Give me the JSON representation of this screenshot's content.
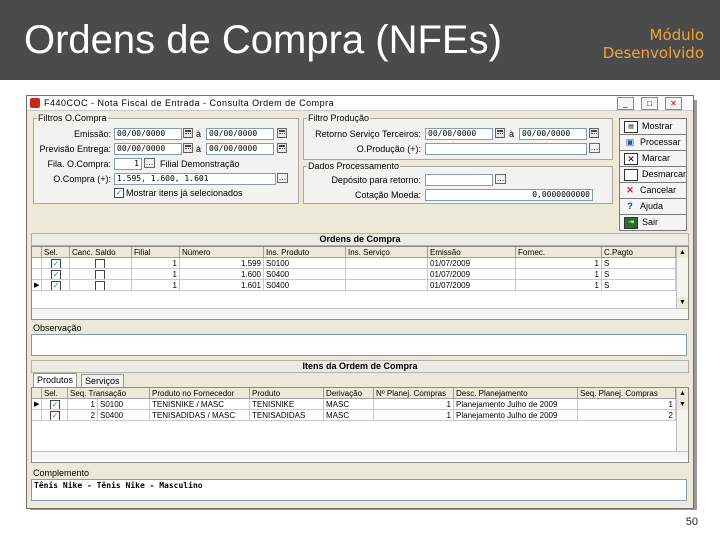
{
  "slide": {
    "title": "Ordens de Compra (NFEs)",
    "subtitle_line1": "Módulo",
    "subtitle_line2": "Desenvolvido",
    "page_number": "50"
  },
  "window": {
    "title": "F440COC - Nota Fiscal de Entrada - Consulta Ordem de Compra"
  },
  "filtros_oc": {
    "legend": "Filtros O.Compra",
    "emissao_label": "Emissão:",
    "emissao_from": "00/00/0000",
    "emissao_to": "00/00/0000",
    "previsao_label": "Previsão Entrega:",
    "previsao_from": "00/00/0000",
    "previsao_to": "00/00/0000",
    "a_label": "à",
    "filial_label": "Fila. O.Compra:",
    "filial_value": "1",
    "filial_name": "Filial Demonstração",
    "ocompra_label": "O.Compra (+):",
    "ocompra_value": "1.595, 1.600, 1.601",
    "mostrar_label": "Mostrar itens já selecionados"
  },
  "filtro_producao": {
    "legend": "Filtro Produção",
    "retorno_label": "Retorno Serviço Terceiros:",
    "retorno_from": "00/00/0000",
    "retorno_to": "00/00/0000",
    "a_label": "à",
    "op_label": "O.Produção (+):",
    "op_value": ""
  },
  "dados_processamento": {
    "legend": "Dados Processamento",
    "deposito_label": "Depósito para retorno:",
    "deposito_value": "",
    "cotacao_label": "Cotação Moeda:",
    "cotacao_value": "0,0000000000"
  },
  "side_buttons": [
    {
      "label": "Mostrar",
      "icon": "show-icon"
    },
    {
      "label": "Processar",
      "icon": "process-icon"
    },
    {
      "label": "Marcar",
      "icon": "mark-icon"
    },
    {
      "label": "Desmarcar",
      "icon": "unmark-icon"
    },
    {
      "label": "Cancelar",
      "icon": "cancel-icon"
    },
    {
      "label": "Ajuda",
      "icon": "help-icon"
    },
    {
      "label": "Sair",
      "icon": "exit-icon"
    }
  ],
  "ordens": {
    "section_title": "Ordens de Compra",
    "columns": [
      "Sel.",
      "Canc. Saldo",
      "Filial",
      "Número",
      "Ins. Produto",
      "Ins. Serviço",
      "Emissão",
      "Fornec.",
      "C.Pagto"
    ],
    "rows": [
      {
        "sel": "✓",
        "canc": "",
        "filial": "1",
        "numero": "1.599",
        "ins_produto": "S0100",
        "ins_servico": "",
        "emissao": "01/07/2009",
        "fornec": "1",
        "cpagto": "S"
      },
      {
        "sel": "✓",
        "canc": "",
        "filial": "1",
        "numero": "1.600",
        "ins_produto": "S0400",
        "ins_servico": "",
        "emissao": "01/07/2009",
        "fornec": "1",
        "cpagto": "S"
      },
      {
        "sel": "✓",
        "canc": "",
        "filial": "1",
        "numero": "1.601",
        "ins_produto": "S0400",
        "ins_servico": "",
        "emissao": "01/07/2009",
        "fornec": "1",
        "cpagto": "S"
      }
    ],
    "observacao_label": "Observação"
  },
  "itens": {
    "section_title": "Itens da Ordem de Compra",
    "tab_produtos": "Produtos",
    "tab_servicos": "Serviços",
    "columns": [
      "Sel.",
      "Seq. Transação",
      "Produto no Fornecedor",
      "Produto",
      "Derivação",
      "Nº Planej. Compras",
      "Desc. Planejamento",
      "Seq. Planej. Compras"
    ],
    "rows": [
      {
        "sel": "✓",
        "seq": "1",
        "transacao": "S0100",
        "prod_fornec": "TENISNIKE / MASC",
        "produto": "TENISNIKE",
        "derivacao": "MASC",
        "planej": "1",
        "desc_planej": "Planejamento Julho de 2009",
        "seq_planej": "1"
      },
      {
        "sel": "✓",
        "seq": "2",
        "transacao": "S0400",
        "prod_fornec": "TENISADIDAS / MASC",
        "produto": "TENISADIDAS",
        "derivacao": "MASC",
        "planej": "1",
        "desc_planej": "Planejamento Julho de 2009",
        "seq_planej": "2"
      }
    ],
    "complemento_label": "Complemento",
    "complemento_value": "Tênis Nike - Tênis Nike - Masculino"
  }
}
